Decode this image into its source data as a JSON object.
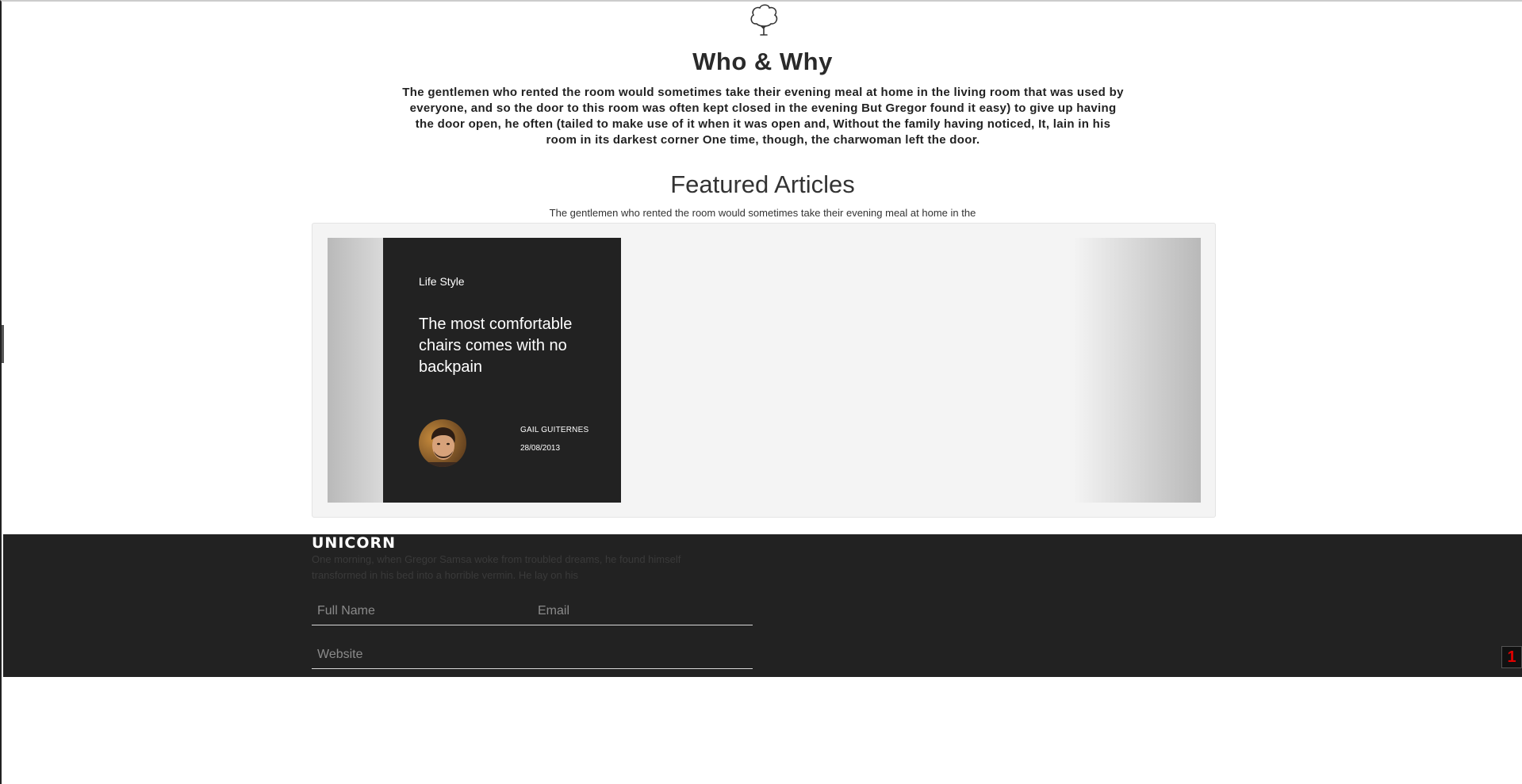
{
  "header": {
    "logo_icon": "tree-icon"
  },
  "who": {
    "title": "Who & Why",
    "text": "The gentlemen who rented the room would sometimes take their evening meal at home in the living room that was used by everyone, and so the door to this room was often kept closed in the evening But Gregor found it easy) to give up having the door open, he often (tailed to make use of it when it was open and, Without the family having noticed, It, lain in his room in its darkest corner One time, though, the charwoman left the door."
  },
  "featured": {
    "title": "Featured Articles",
    "subtitle": "The gentlemen who rented the room would sometimes take their evening meal at home in the",
    "articles": [
      {
        "category": "Life Style",
        "title": "The most comfortable chairs comes with no backpain",
        "author": "GAIL GUITERNES",
        "date": "28/08/2013",
        "avatar_icon": "author-avatar"
      }
    ]
  },
  "footer": {
    "brand": "UNICORN",
    "text": "One morning, when Gregor Samsa woke from troubled dreams, he found himself transformed in his bed into a horrible vermin. He lay on his",
    "form": {
      "name_placeholder": "Full Name",
      "email_placeholder": "Email",
      "website_placeholder": "Website"
    }
  },
  "widget": {
    "label": "1"
  },
  "colors": {
    "dark": "#222222",
    "panel": "#f4f4f4",
    "widget_red": "#e00000"
  }
}
